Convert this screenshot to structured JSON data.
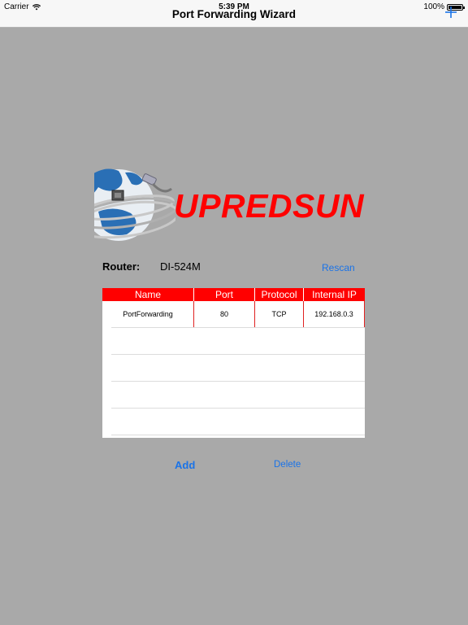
{
  "status_bar": {
    "carrier": "Carrier",
    "time": "5:39 PM",
    "battery": "100%"
  },
  "nav": {
    "title": "Port Forwarding Wizard",
    "add_icon": "plus-icon"
  },
  "logo": {
    "text": "UPREDSUN"
  },
  "router": {
    "label": "Router:",
    "value": "DI-524M",
    "rescan_label": "Rescan"
  },
  "table": {
    "columns": [
      "Name",
      "Port",
      "Protocol",
      "Internal IP"
    ],
    "rows": [
      {
        "name": "PortForwarding",
        "port": "80",
        "protocol": "TCP",
        "ip": "192.168.0.3"
      }
    ]
  },
  "actions": {
    "add_label": "Add",
    "delete_label": "Delete"
  },
  "colors": {
    "background": "#a9a9a9",
    "accent_blue": "#1a73e8",
    "header_red": "#ff0000"
  }
}
